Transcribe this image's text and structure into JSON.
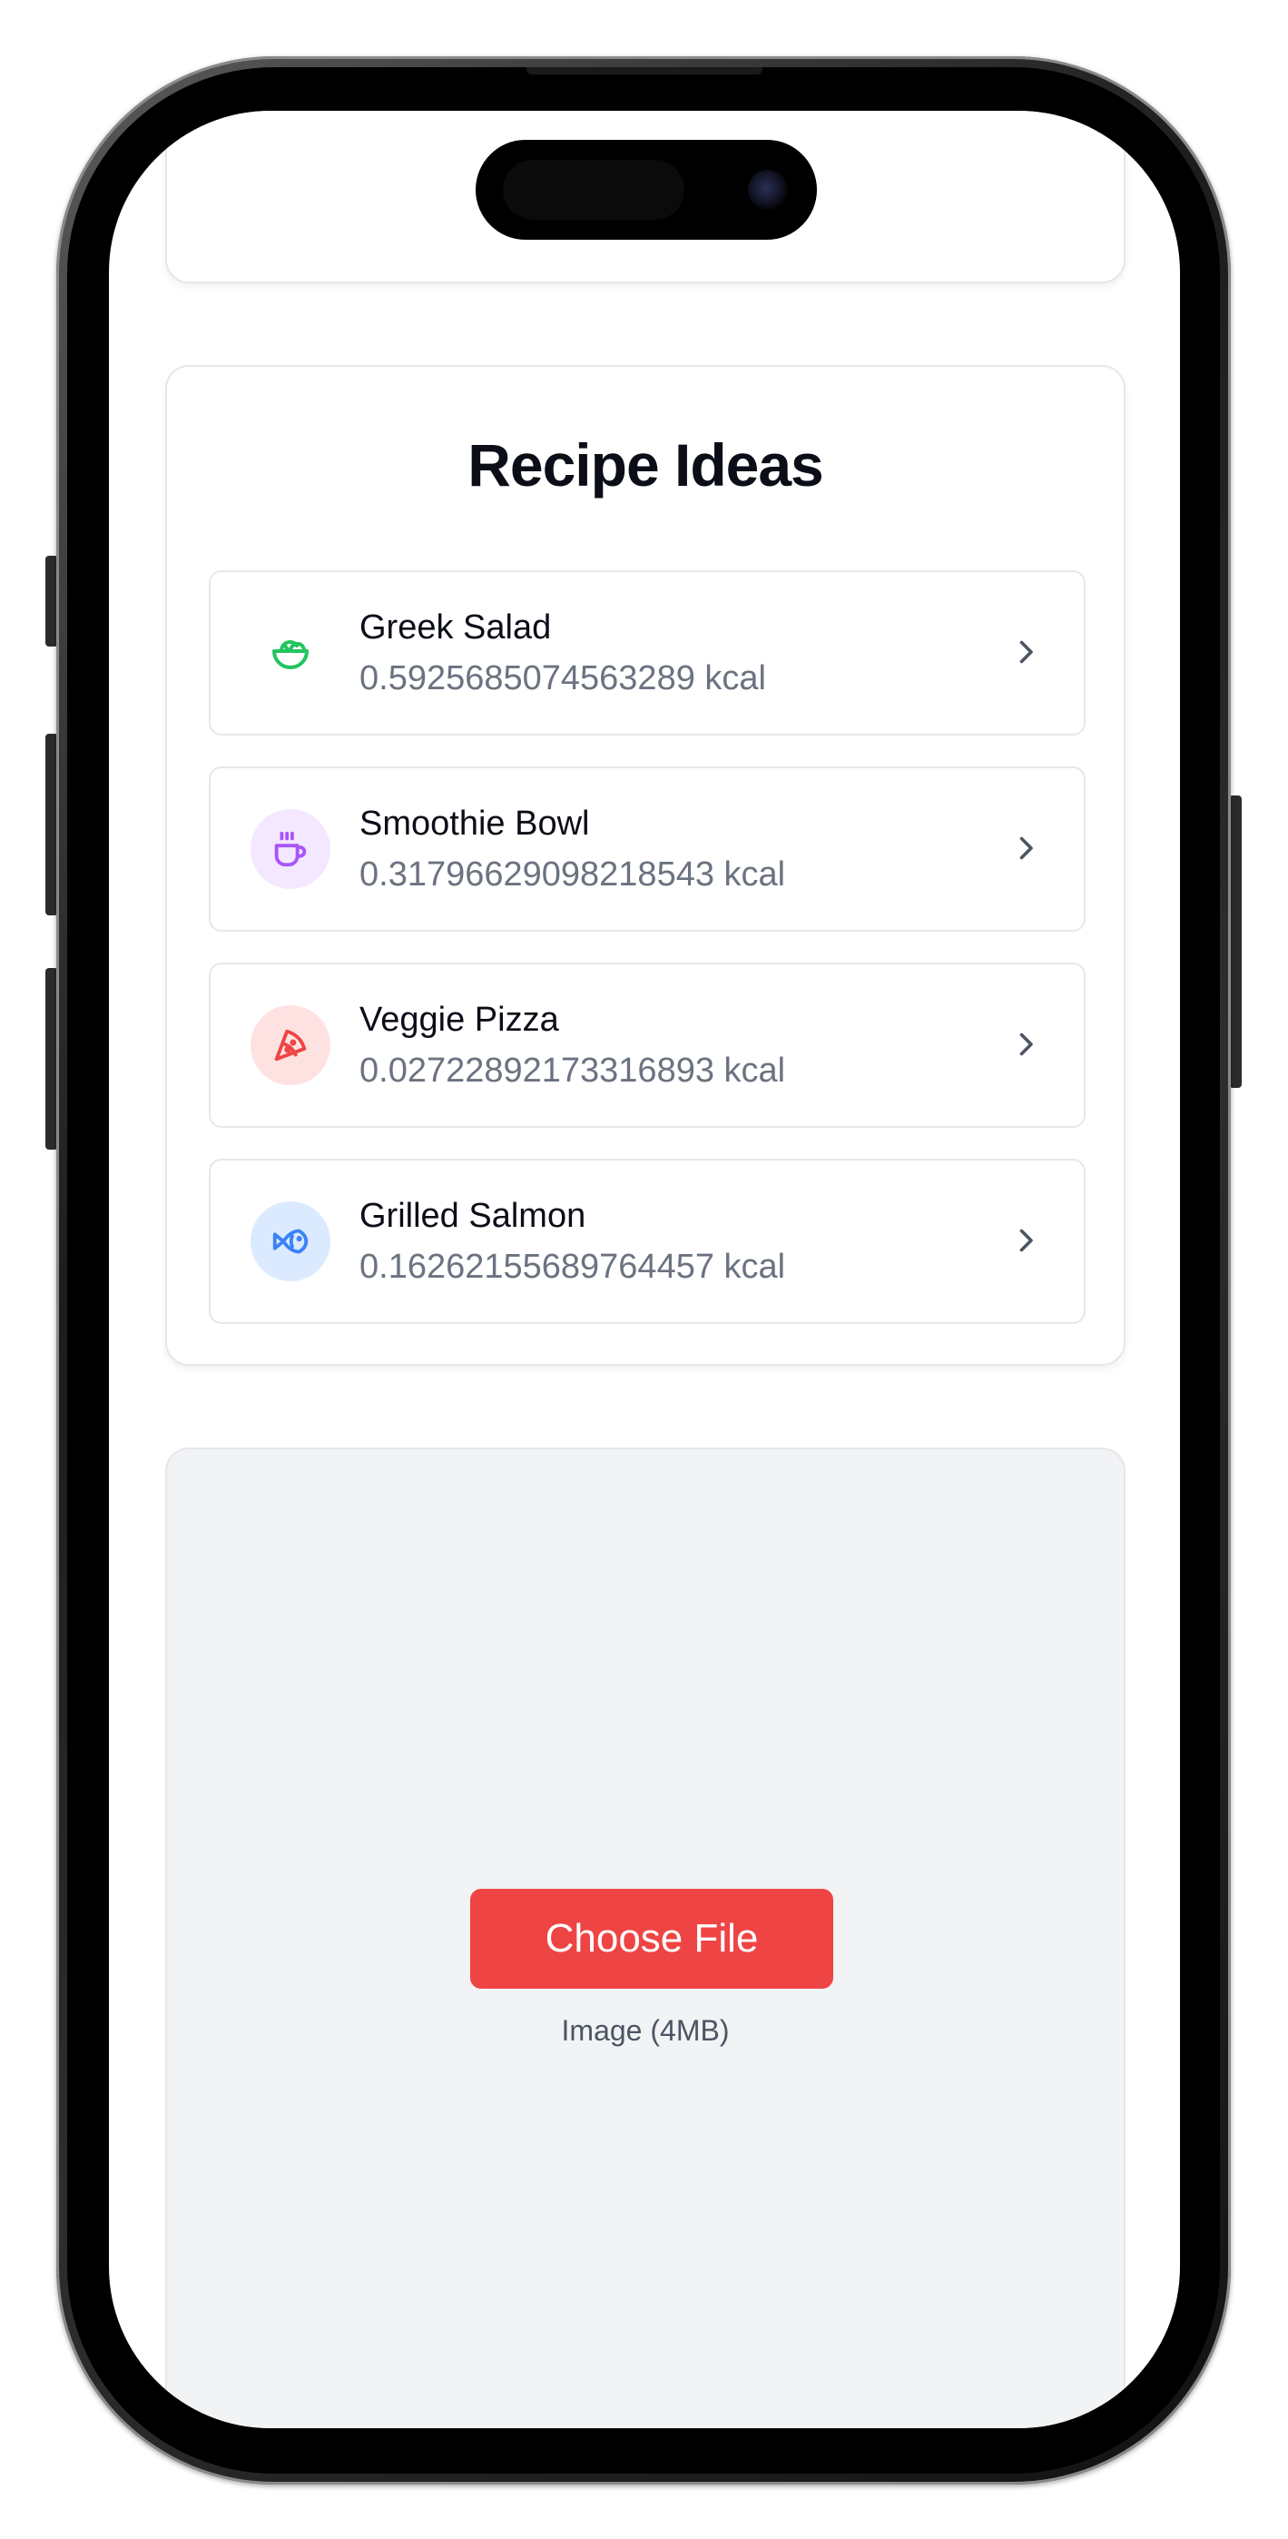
{
  "recipes_section": {
    "title": "Recipe Ideas",
    "items": [
      {
        "name": "Greek Salad",
        "kcal": "0.5925685074563289 kcal",
        "icon": "salad-icon",
        "icon_color": "#22c55e",
        "icon_bg": "#ffffff"
      },
      {
        "name": "Smoothie Bowl",
        "kcal": "0.31796629098218543 kcal",
        "icon": "coffee-cup-icon",
        "icon_color": "#a855f7",
        "icon_bg": "#f3e8ff"
      },
      {
        "name": "Veggie Pizza",
        "kcal": "0.02722892173316893 kcal",
        "icon": "pizza-icon",
        "icon_color": "#ef4444",
        "icon_bg": "#fee2e2"
      },
      {
        "name": "Grilled Salmon",
        "kcal": "0.16262155689764457 kcal",
        "icon": "fish-icon",
        "icon_color": "#3b82f6",
        "icon_bg": "#dbeafe"
      }
    ]
  },
  "upload": {
    "button_label": "Choose File",
    "hint": "Image (4MB)",
    "button_color": "#ef4444"
  }
}
